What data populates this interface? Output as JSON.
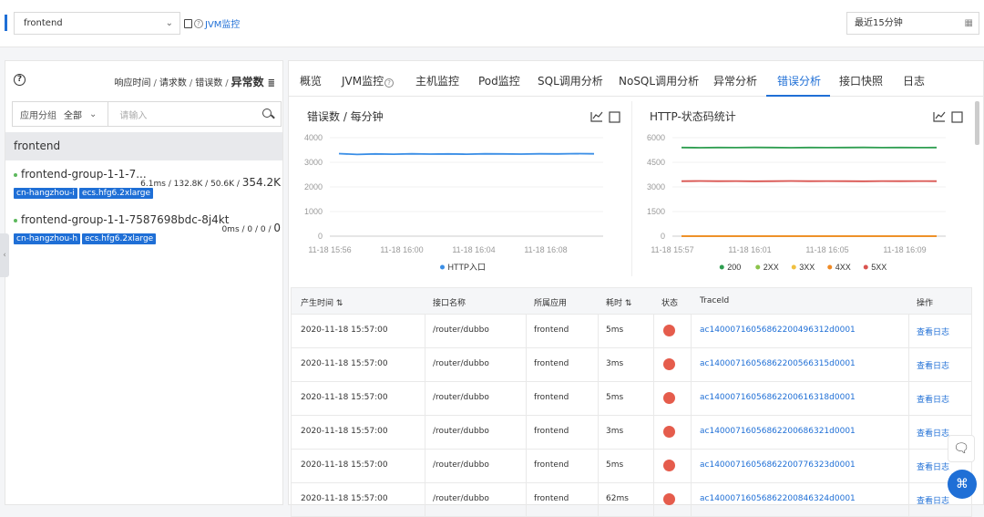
{
  "topbar": {
    "app_select_value": "frontend",
    "jvm_toggle_label": "JVM监控",
    "time_range_value": "最近15分钟"
  },
  "left_panel": {
    "metric_tabs": [
      "响应时间",
      "请求数",
      "错误数",
      "异常数"
    ],
    "filter": {
      "group_label": "应用分组",
      "group_value": "全部",
      "search_placeholder": "请输入"
    },
    "group_name": "frontend",
    "instances": [
      {
        "name": "frontend-group-1-1-7...",
        "stats_prefix": "6.1ms / 132.8K / 50.6K / ",
        "stats_last": "354.2K",
        "tags": [
          "cn-hangzhou-i",
          "ecs.hfg6.2xlarge"
        ]
      },
      {
        "name": "frontend-group-1-1-7587698bdc-8j4kt",
        "stats_prefix": "0ms / 0 / 0 / ",
        "stats_last": "0",
        "tags": [
          "cn-hangzhou-h",
          "ecs.hfg6.2xlarge"
        ]
      }
    ]
  },
  "tabs": [
    "概览",
    "JVM监控",
    "主机监控",
    "Pod监控",
    "SQL调用分析",
    "NoSQL调用分析",
    "异常分析",
    "错误分析",
    "接口快照",
    "日志"
  ],
  "active_tab": "错误分析",
  "chart_data": [
    {
      "type": "line",
      "title": "错误数 / 每分钟",
      "x": [
        "11-18 15:56",
        "11-18 16:00",
        "11-18 16:04",
        "11-18 16:08"
      ],
      "ylim": [
        0,
        4000
      ],
      "yticks": [
        "0",
        "1000",
        "2000",
        "3000",
        "4000"
      ],
      "series": [
        {
          "name": "HTTP入口",
          "color": "#3a8ee6",
          "values": [
            3350,
            3320,
            3340,
            3330,
            3345,
            3335,
            3340,
            3330,
            3345,
            3340,
            3335,
            3345,
            3340,
            3350,
            3345
          ]
        }
      ],
      "legend": "bottom"
    },
    {
      "type": "line",
      "title": "HTTP-状态码统计",
      "x": [
        "11-18 15:57",
        "11-18 16:01",
        "11-18 16:05",
        "11-18 16:09"
      ],
      "ylim": [
        0,
        6000
      ],
      "yticks": [
        "0",
        "1500",
        "3000",
        "4500",
        "6000"
      ],
      "series": [
        {
          "name": "200",
          "color": "#2e9e50",
          "values": [
            5400,
            5390,
            5400,
            5395,
            5405,
            5400,
            5390,
            5400,
            5395,
            5400,
            5405,
            5395,
            5400,
            5395,
            5400
          ]
        },
        {
          "name": "2XX",
          "color": "#8bc34a",
          "values": [
            0,
            0,
            0,
            0,
            0,
            0,
            0,
            0,
            0,
            0,
            0,
            0,
            0,
            0,
            0
          ]
        },
        {
          "name": "3XX",
          "color": "#f0c040",
          "values": [
            0,
            0,
            0,
            0,
            0,
            0,
            0,
            0,
            0,
            0,
            0,
            0,
            0,
            0,
            0
          ]
        },
        {
          "name": "4XX",
          "color": "#f08a24",
          "values": [
            0,
            0,
            0,
            0,
            0,
            0,
            0,
            0,
            0,
            0,
            0,
            0,
            0,
            0,
            0
          ]
        },
        {
          "name": "5XX",
          "color": "#d9534f",
          "values": [
            3350,
            3360,
            3350,
            3355,
            3345,
            3350,
            3360,
            3350,
            3355,
            3350,
            3345,
            3355,
            3350,
            3355,
            3350
          ]
        }
      ],
      "legend": "bottom"
    }
  ],
  "table": {
    "headers": [
      "产生时间",
      "接口名称",
      "所属应用",
      "耗时",
      "状态",
      "TraceId",
      "操作"
    ],
    "rows": [
      {
        "time": "2020-11-18 15:57:00",
        "api": "/router/dubbo",
        "app": "frontend",
        "cost": "5ms",
        "trace": "ac14000716056862200496312d0001",
        "action": "查看日志"
      },
      {
        "time": "2020-11-18 15:57:00",
        "api": "/router/dubbo",
        "app": "frontend",
        "cost": "3ms",
        "trace": "ac14000716056862200566315d0001",
        "action": "查看日志"
      },
      {
        "time": "2020-11-18 15:57:00",
        "api": "/router/dubbo",
        "app": "frontend",
        "cost": "5ms",
        "trace": "ac14000716056862200616318d0001",
        "action": "查看日志"
      },
      {
        "time": "2020-11-18 15:57:00",
        "api": "/router/dubbo",
        "app": "frontend",
        "cost": "3ms",
        "trace": "ac14000716056862200686321d0001",
        "action": "查看日志"
      },
      {
        "time": "2020-11-18 15:57:00",
        "api": "/router/dubbo",
        "app": "frontend",
        "cost": "5ms",
        "trace": "ac14000716056862200776323d0001",
        "action": "查看日志"
      },
      {
        "time": "2020-11-18 15:57:00",
        "api": "/router/dubbo",
        "app": "frontend",
        "cost": "62ms",
        "trace": "ac14000716056862200846324d0001",
        "action": "查看日志"
      }
    ]
  },
  "colors": {
    "accent": "#1f6fd6",
    "status_error": "#e55c4c"
  }
}
